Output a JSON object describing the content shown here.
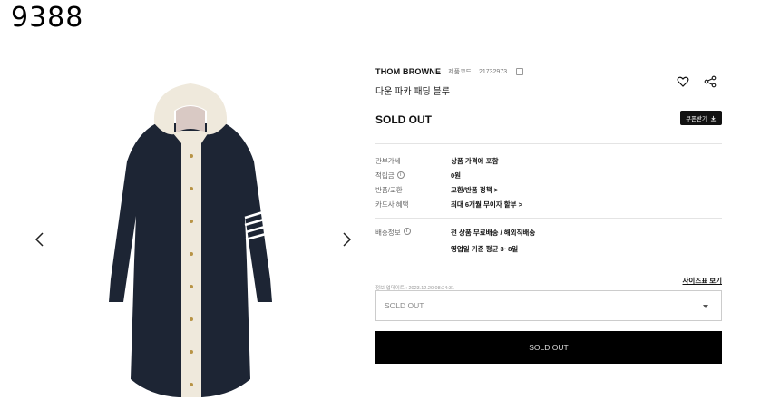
{
  "header": {
    "logo_text": "9388"
  },
  "gallery": {
    "prev_icon": "chevron-left-icon",
    "next_icon": "chevron-right-icon"
  },
  "product": {
    "brand": "THOM BROWNE",
    "code_label": "제품코드",
    "code_value": "21732973",
    "name": "다운 파카 패딩 블루",
    "status": "SOLD OUT",
    "coupon_label": "쿠폰받기"
  },
  "details": [
    {
      "label": "관부가세",
      "value": "상품 가격에 포함",
      "info": false
    },
    {
      "label": "적립금",
      "value": "0원",
      "info": true
    },
    {
      "label": "반품/교환",
      "value": "교환/반품 정책 >",
      "info": false
    },
    {
      "label": "카드사 혜택",
      "value": "최대 6개월 무이자 할부 >",
      "info": false
    }
  ],
  "shipping": {
    "label": "배송정보",
    "line1": "전 상품 무료배송 / 해외직배송",
    "line2": "영업일 기준 평균 3~8일"
  },
  "update_text": "정보 업데이트 : 2023.12.20 08:24:31",
  "size_guide_label": "사이즈표 보기",
  "option_select": {
    "selected": "SOLD OUT"
  },
  "buy_button_label": "SOLD OUT",
  "colors": {
    "primary": "#000000",
    "coat_navy": "#1d2534",
    "coat_cream": "#efe9dc"
  }
}
